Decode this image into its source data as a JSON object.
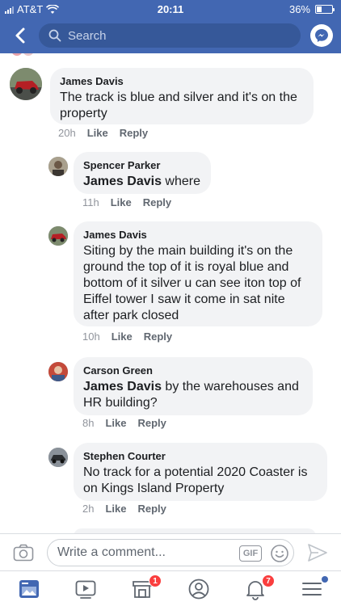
{
  "status_bar": {
    "carrier": "AT&T",
    "time": "20:11",
    "battery": "36%",
    "battery_level": 0.36
  },
  "nav": {
    "search_placeholder": "Search"
  },
  "comments": [
    {
      "author": "James Davis",
      "mention": "",
      "text": "The track is blue and silver and it's on the property",
      "time": "20h",
      "like": "Like",
      "reply": "Reply"
    },
    {
      "author": "Spencer Parker",
      "mention": "James Davis",
      "text": " where",
      "time": "11h",
      "like": "Like",
      "reply": "Reply"
    },
    {
      "author": "James Davis",
      "mention": "",
      "text": "Siting by the main building it's on the ground the top of it is royal blue and bottom of it silver u can see iton top of Eiffel tower I saw it come in sat nite after park closed",
      "time": "10h",
      "like": "Like",
      "reply": "Reply"
    },
    {
      "author": "Carson Green",
      "mention": "James Davis",
      "text": " by the warehouses and HR building?",
      "time": "8h",
      "like": "Like",
      "reply": "Reply"
    },
    {
      "author": "Stephen Courter",
      "mention": "",
      "text": "No track for a potential 2020 Coaster is on Kings Island Property",
      "time": "2h",
      "like": "Like",
      "reply": "Reply"
    }
  ],
  "composer": {
    "placeholder": "Write a comment...",
    "gif_label": "GIF"
  },
  "tabbar": {
    "marketplace_badge": "1",
    "notifications_badge": "7"
  },
  "colors": {
    "brand": "#4267b2",
    "bubble": "#f2f3f5",
    "badge": "#fa3e3e"
  }
}
